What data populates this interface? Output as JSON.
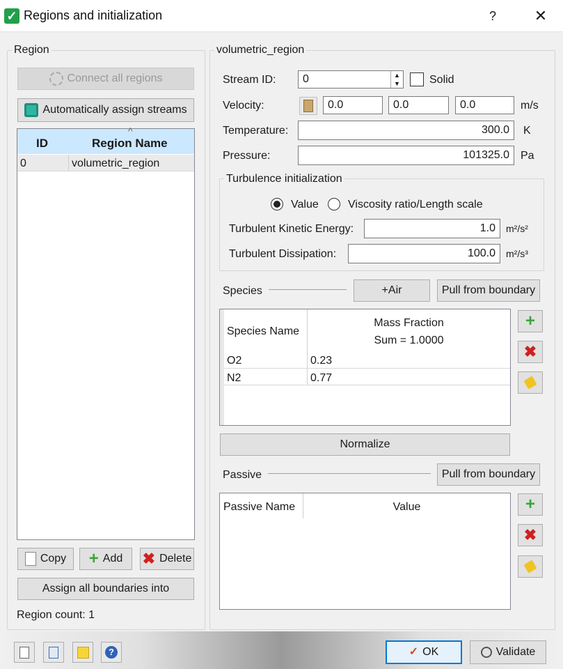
{
  "window": {
    "title": "Regions and initialization",
    "help": "?",
    "close": "✕"
  },
  "region": {
    "group_label": "Region",
    "connect_all": "Connect all regions",
    "auto_assign": "Automatically assign streams",
    "columns": [
      "ID",
      "Region Name"
    ],
    "sort_glyph": "^",
    "rows": [
      {
        "id": "0",
        "name": "volumetric_region"
      }
    ],
    "copy": "Copy",
    "add": "Add",
    "delete": "Delete",
    "assign_all": "Assign all boundaries into",
    "count_label": "Region count: 1"
  },
  "volumetric": {
    "group_label": "volumetric_region",
    "stream_id_label": "Stream ID:",
    "stream_id": "0",
    "solid_label": "Solid",
    "velocity_label": "Velocity:",
    "velocity": [
      "0.0",
      "0.0",
      "0.0"
    ],
    "velocity_unit": "m/s",
    "temperature_label": "Temperature:",
    "temperature": "300.0",
    "temperature_unit": "K",
    "pressure_label": "Pressure:",
    "pressure": "101325.0",
    "pressure_unit": "Pa"
  },
  "turbulence": {
    "group_label": "Turbulence initialization",
    "radio_value": "Value",
    "radio_viscosity": "Viscosity ratio/Length scale",
    "selected": "Value",
    "tke_label": "Turbulent Kinetic Energy:",
    "tke": "1.0",
    "tke_unit": "m²/s²",
    "diss_label": "Turbulent Dissipation:",
    "diss": "100.0",
    "diss_unit": "m²/s³"
  },
  "species": {
    "label": "Species",
    "add_air": "+Air",
    "pull": "Pull from boundary",
    "col_name": "Species Name",
    "col_mass": "Mass Fraction",
    "col_sum": "Sum = 1.0000",
    "rows": [
      {
        "name": "O2",
        "value": "0.23"
      },
      {
        "name": "N2",
        "value": "0.77"
      }
    ],
    "normalize": "Normalize"
  },
  "passive": {
    "label": "Passive",
    "pull": "Pull from boundary",
    "col_name": "Passive Name",
    "col_value": "Value"
  },
  "footer": {
    "ok": "OK",
    "validate": "Validate"
  },
  "colors": {
    "accent": "#0078d7",
    "check_green": "#21a04a",
    "selection": "#cce8ff",
    "header_blue": "#cce8ff"
  }
}
